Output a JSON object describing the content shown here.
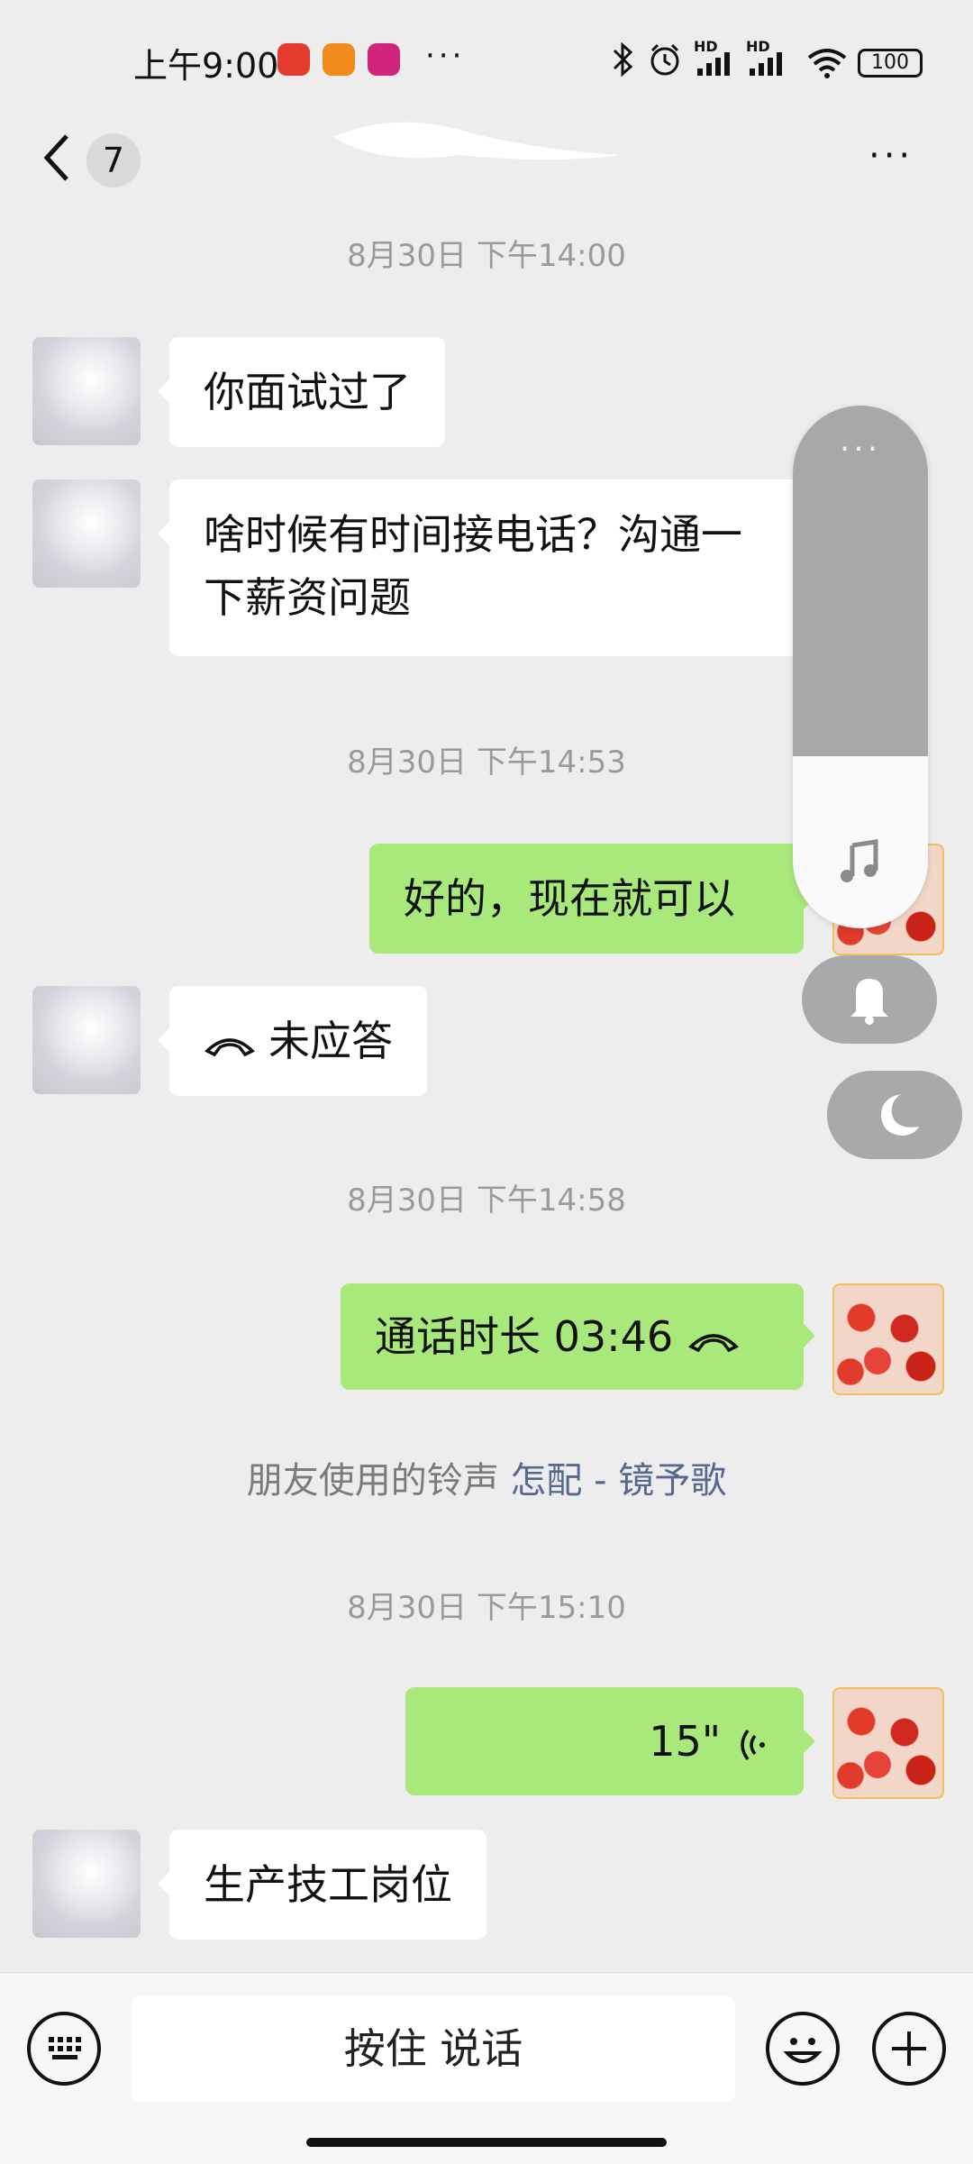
{
  "status_bar": {
    "time": "上午9:00",
    "more": "···",
    "signal1": "HD",
    "signal2": "HD",
    "battery": "100"
  },
  "header": {
    "back_label": "7",
    "more": "···"
  },
  "messages": {
    "ts1": "8月30日 下午14:00",
    "m1": "你面试过了",
    "m2_line1": "啥时候有时间接电话？沟通一",
    "m2_line2": "下薪资问题",
    "ts2": "8月30日 下午14:53",
    "m3": "好的，现在就可以",
    "m4": "未应答",
    "ts3": "8月30日 下午14:58",
    "m5": "通话时长 03:46",
    "ringtone_prefix": "朋友使用的铃声",
    "ringtone_link": "怎配 - 镜予歌",
    "ts4": "8月30日 下午15:10",
    "m6_duration": "15\"",
    "m7": "生产技工岗位"
  },
  "volume_panel": {
    "dots": "···",
    "level": 0.33
  },
  "input_bar": {
    "talk_label": "按住 说话"
  },
  "colors": {
    "background": "#ededed",
    "bubble_self": "#a9e97b",
    "bubble_other": "#ffffff",
    "link": "#57688f"
  }
}
